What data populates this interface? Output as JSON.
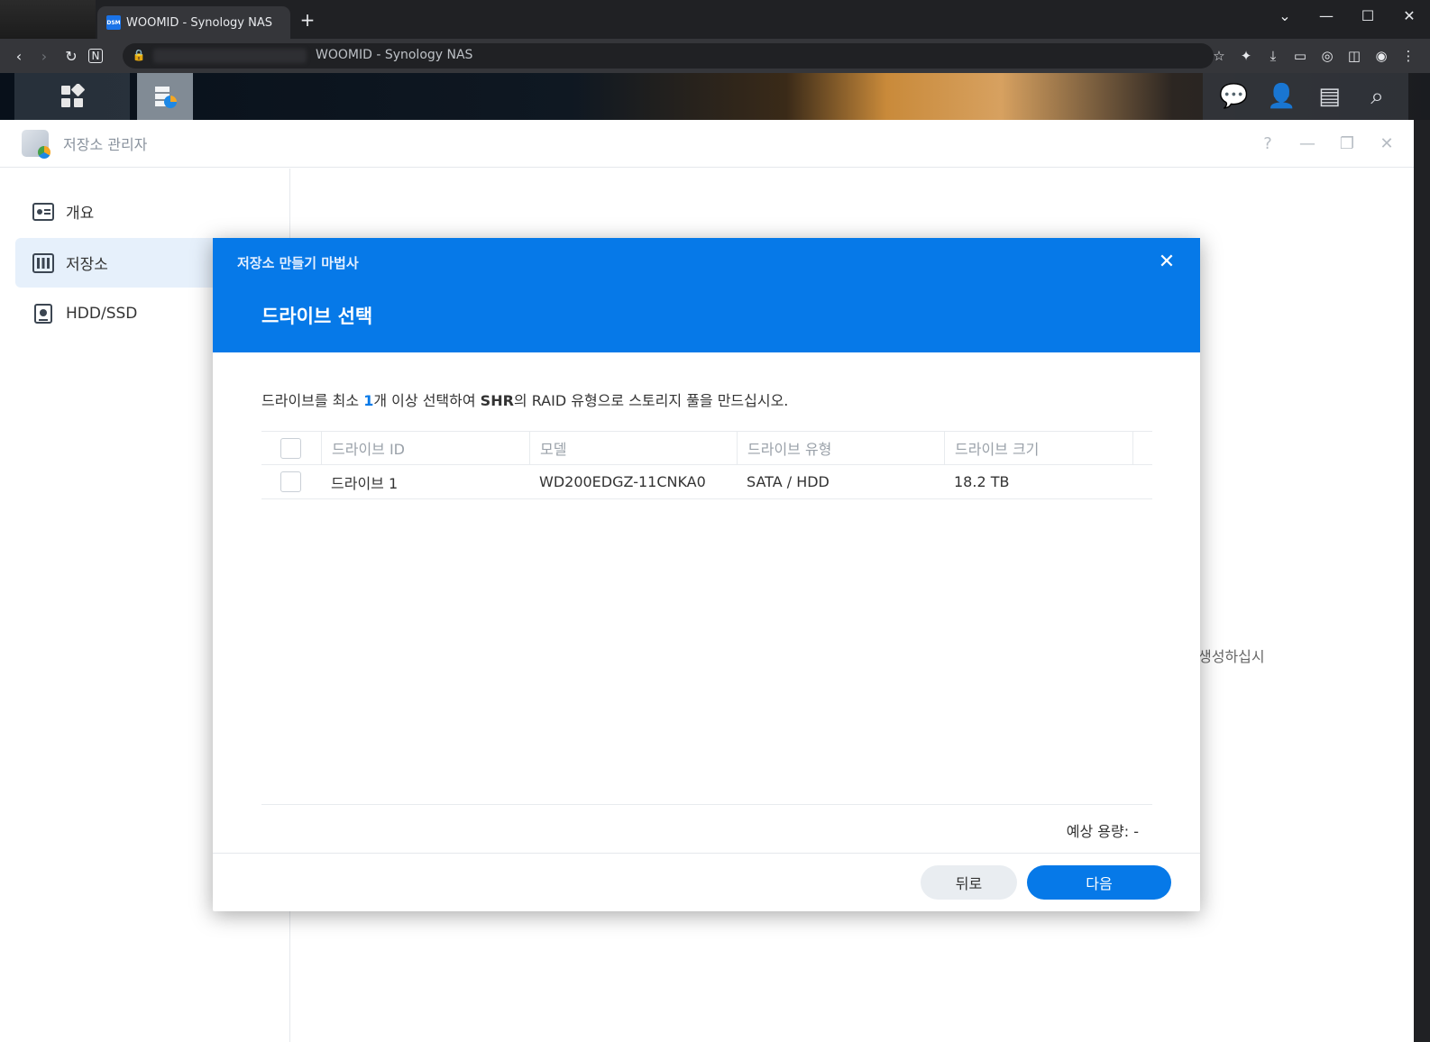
{
  "browser": {
    "tab_title": "WOOMID - Synology NAS",
    "tab_favicon": "DSM",
    "new_tab": "+",
    "address": "WOOMID - Synology NAS"
  },
  "app": {
    "title": "저장소 관리자",
    "sidebar": [
      {
        "label": "개요",
        "icon": "overview-icon"
      },
      {
        "label": "저장소",
        "icon": "storage-icon"
      },
      {
        "label": "HDD/SSD",
        "icon": "drive-icon"
      }
    ],
    "background_hint": "생성하십시"
  },
  "wizard": {
    "title": "저장소 만들기 마법사",
    "step": "드라이브 선택",
    "instruction": {
      "part1": "드라이브를 최소 ",
      "count": "1",
      "part2": "개 이상 선택하여 ",
      "raid": "SHR",
      "part3": "의 RAID 유형으로 스토리지 풀을 만드십시오."
    },
    "columns": [
      "드라이브 ID",
      "모델",
      "드라이브 유형",
      "드라이브 크기"
    ],
    "rows": [
      {
        "id": "드라이브 1",
        "model": "WD200EDGZ-11CNKA0",
        "type": "SATA / HDD",
        "size": "18.2 TB"
      }
    ],
    "capacity_label": "예상 용량: -",
    "back_label": "뒤로",
    "next_label": "다음"
  },
  "colors": {
    "accent": "#0679e8",
    "selected_bg": "#e6f0fb"
  }
}
